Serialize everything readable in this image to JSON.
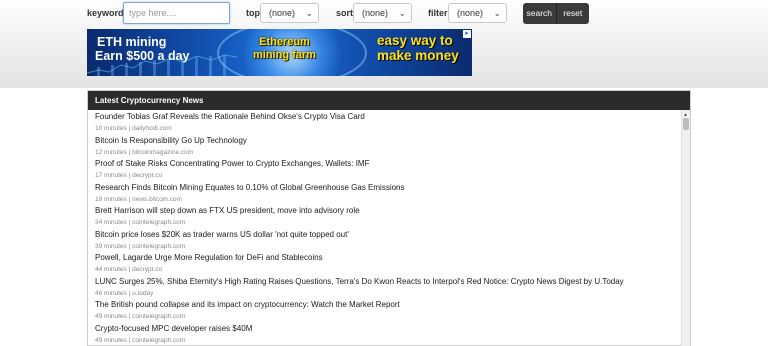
{
  "search": {
    "keywords_label": "keywords",
    "keywords_placeholder": "type here....",
    "top_label": "top",
    "top_selected": "(none)",
    "sort_label": "sort",
    "sort_selected": "(none)",
    "filter_label": "filter",
    "filter_selected": "(none)",
    "search_button": "search",
    "reset_button": "reset"
  },
  "banner": {
    "left_line1": "ETH mining",
    "left_line2": "Earn $500 a day",
    "mid_line1": "Ethereum",
    "mid_line2": "mining farm",
    "right_line1": "easy way to",
    "right_line2": "make money"
  },
  "news": {
    "header": "Latest Cryptocurrency News",
    "items": [
      {
        "title": "Founder Tobias Graf Reveals the Rationale Behind Okse's Crypto Visa Card",
        "meta": "10 minutes | dailyhodl.com"
      },
      {
        "title": "Bitcoin Is Responsibility Go Up Technology",
        "meta": "12 minutes | bitcoinmagazine.com"
      },
      {
        "title": "Proof of Stake Risks Concentrating Power to Crypto Exchanges, Wallets: IMF",
        "meta": "17 minutes | decrypt.co"
      },
      {
        "title": "Research Finds Bitcoin Mining Equates to 0.10% of Global Greenhouse Gas Emissions",
        "meta": "19 minutes | news.bitcoin.com"
      },
      {
        "title": "Brett Harrison will step down as FTX US president, move into advisory role",
        "meta": "34 minutes | cointelegraph.com"
      },
      {
        "title": "Bitcoin price loses $20K as trader warns US dollar 'not quite topped out'",
        "meta": "39 minutes | cointelegraph.com"
      },
      {
        "title": "Powell, Lagarde Urge More Regulation for DeFi and Stablecoins",
        "meta": "44 minutes | decrypt.co"
      },
      {
        "title": "LUNC Surges 25%, Shiba Eternity's High Rating Raises Questions, Terra's Do Kwon Reacts to Interpol's Red Notice: Crypto News Digest by U.Today",
        "meta": "46 minutes | u.today"
      },
      {
        "title": "The British pound collapse and its impact on cryptocurrency: Watch the Market Report",
        "meta": "49 minutes | cointelegraph.com"
      },
      {
        "title": "Crypto-focused MPC developer raises $40M",
        "meta": "49 minutes | cointelegraph.com"
      }
    ]
  }
}
